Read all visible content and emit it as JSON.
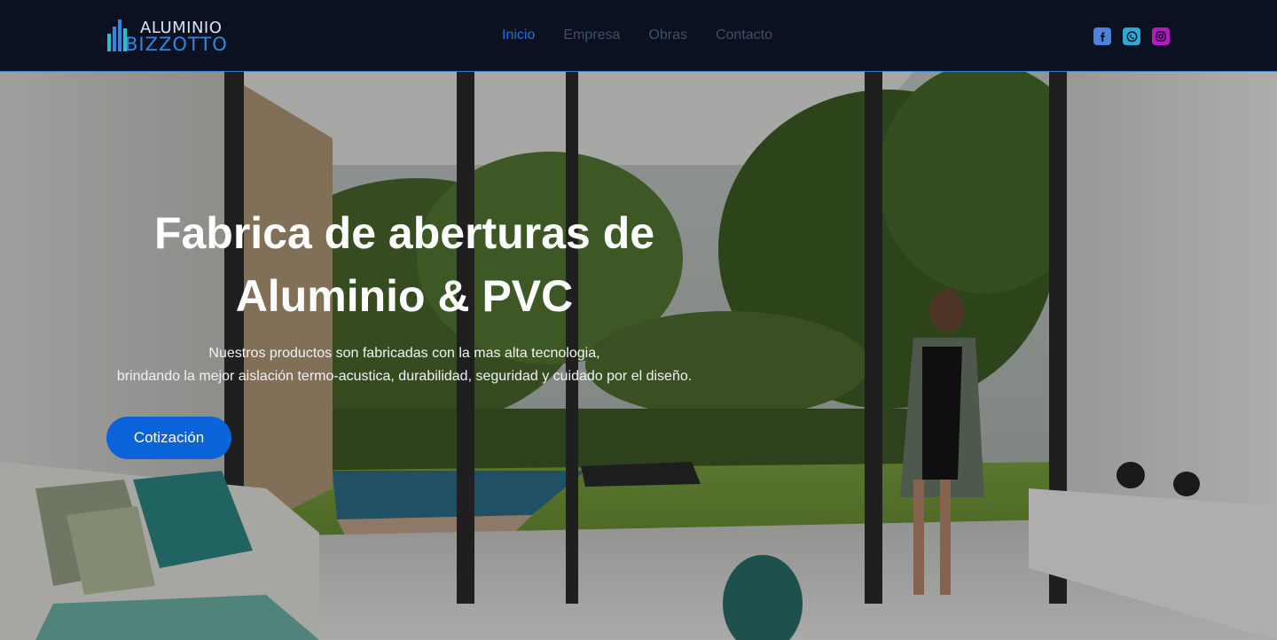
{
  "brand": {
    "name_top": "ALUMINIO",
    "name_bottom": "IZZOTTO",
    "logo_letter": "B",
    "colors": {
      "light": "#d8e4f5",
      "accent": "#2f88e6"
    }
  },
  "nav": {
    "items": [
      {
        "label": "Inicio",
        "active": true
      },
      {
        "label": "Empresa",
        "active": false
      },
      {
        "label": "Obras",
        "active": false
      },
      {
        "label": "Contacto",
        "active": false
      }
    ],
    "active_color": "#1f6fdc",
    "inactive_color": "#3f5168"
  },
  "social": [
    {
      "icon": "facebook-icon",
      "color": "#4e82d6"
    },
    {
      "icon": "whatsapp-icon",
      "color": "#2fa9cf"
    },
    {
      "icon": "instagram-icon",
      "color": "#b41ac4"
    }
  ],
  "hero": {
    "title_line1": "Fabrica de aberturas de",
    "title_line2": "Aluminio & PVC",
    "subtitle_line1": "Nuestros productos son fabricadas con la mas alta tecnologia,",
    "subtitle_line2": "brindando la mejor aislación termo-acustica, durabilidad, seguridad y cuidado por el diseño.",
    "cta_label": "Cotización",
    "cta_color": "#0a63d9"
  }
}
